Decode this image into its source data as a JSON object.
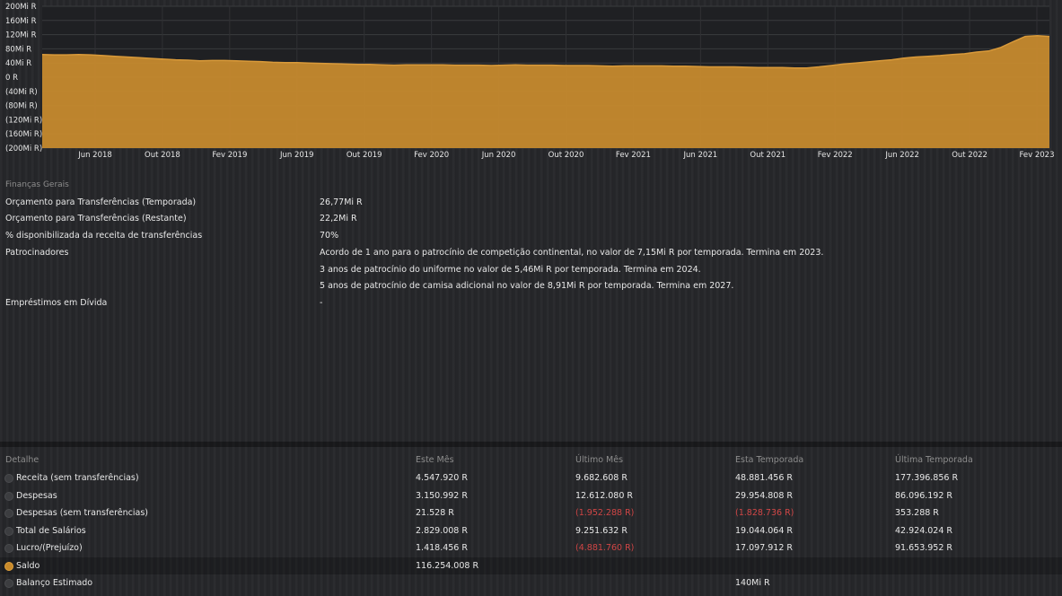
{
  "chart_data": {
    "type": "area",
    "y_ticks": [
      "200Mi R",
      "160Mi R",
      "120Mi R",
      "80Mi R",
      "40Mi R",
      "0 R",
      "(40Mi R)",
      "(80Mi R)",
      "(120Mi R)",
      "(160Mi R)",
      "(200Mi R)"
    ],
    "ylim": [
      -200,
      200
    ],
    "x_ticks": [
      "Jun 2018",
      "Out 2018",
      "Fev 2019",
      "Jun 2019",
      "Out 2019",
      "Fev 2020",
      "Jun 2020",
      "Out 2020",
      "Fev 2021",
      "Jun 2021",
      "Out 2021",
      "Fev 2022",
      "Jun 2022",
      "Out 2022",
      "Fev 2023"
    ],
    "values": [
      64,
      63,
      63,
      64,
      63,
      61,
      59,
      57,
      55,
      53,
      51,
      49,
      48,
      46,
      47,
      47,
      46,
      45,
      44,
      42,
      41,
      41,
      40,
      39,
      38,
      37,
      36,
      36,
      35,
      34,
      35,
      35,
      35,
      35,
      34,
      34,
      34,
      33,
      34,
      35,
      34,
      34,
      34,
      33,
      33,
      33,
      32,
      31,
      32,
      32,
      32,
      32,
      31,
      31,
      30,
      29,
      29,
      29,
      28,
      27,
      27,
      27,
      26,
      26,
      29,
      33,
      37,
      40,
      43,
      46,
      49,
      54,
      57,
      59,
      61,
      64,
      66,
      71,
      74,
      84,
      100,
      115,
      117,
      115
    ],
    "color": "#c68a2e",
    "grid": true
  },
  "finance": {
    "title": "Finanças Gerais",
    "rows": [
      {
        "label": "Orçamento para Transferências (Temporada)",
        "value": "26,77Mi R"
      },
      {
        "label": "Orçamento para Transferências (Restante)",
        "value": "22,2Mi R"
      },
      {
        "label": "% disponibilizada da receita de transferências",
        "value": "70%"
      }
    ],
    "sponsors_label": "Patrocinadores",
    "sponsors": [
      "Acordo de 1 ano para o patrocínio de competição continental, no valor de 7,15Mi R por temporada. Termina em 2023.",
      "3 anos de patrocínio do uniforme no valor de 5,46Mi R por temporada. Termina em 2024.",
      "5 anos de patrocínio de camisa adicional no valor de 8,91Mi R por temporada. Termina em 2027."
    ],
    "loans_label": "Empréstimos em Dívida",
    "loans_value": "-"
  },
  "detail": {
    "headers": [
      "Detalhe",
      "Este Mês",
      "Último Mês",
      "Esta Temporada",
      "Última Temporada"
    ],
    "rows": [
      {
        "label": "Receita (sem transferências)",
        "values": [
          "4.547.920 R",
          "9.682.608 R",
          "48.881.456 R",
          "177.396.856 R"
        ],
        "neg": [
          false,
          false,
          false,
          false
        ]
      },
      {
        "label": "Despesas",
        "values": [
          "3.150.992 R",
          "12.612.080 R",
          "29.954.808 R",
          "86.096.192 R"
        ],
        "neg": [
          false,
          false,
          false,
          false
        ]
      },
      {
        "label": "Despesas (sem transferências)",
        "values": [
          "21.528 R",
          "(1.952.288 R)",
          "(1.828.736 R)",
          "353.288 R"
        ],
        "neg": [
          false,
          true,
          true,
          false
        ]
      },
      {
        "label": "Total de Salários",
        "values": [
          "2.829.008 R",
          "9.251.632 R",
          "19.044.064 R",
          "42.924.024 R"
        ],
        "neg": [
          false,
          false,
          false,
          false
        ]
      },
      {
        "label": "Lucro/(Prejuízo)",
        "values": [
          "1.418.456 R",
          "(4.881.760 R)",
          "17.097.912 R",
          "91.653.952 R"
        ],
        "neg": [
          false,
          true,
          false,
          false
        ]
      }
    ],
    "saldo_label": "Saldo",
    "saldo_value": "116.254.008 R",
    "balanco_label": "Balanço Estimado",
    "balanco_value": "140Mi R"
  }
}
